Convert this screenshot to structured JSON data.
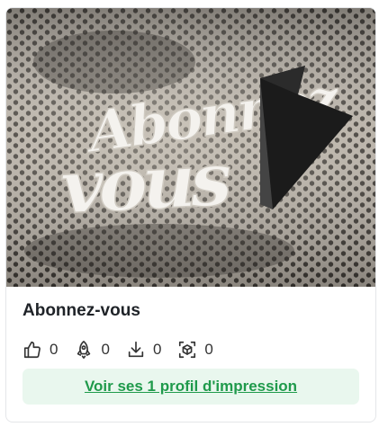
{
  "card": {
    "title": "Abonnez-vous",
    "image_alt": "Abonnez-vous",
    "stats": [
      {
        "icon": "thumbs-up-icon",
        "count": "0"
      },
      {
        "icon": "rocket-icon",
        "count": "0"
      },
      {
        "icon": "download-icon",
        "count": "0"
      },
      {
        "icon": "3d-box-icon",
        "count": "0"
      }
    ],
    "cta_label": "Voir ses 1 profil d'impression",
    "colors": {
      "accent": "#1f9a4b",
      "cta_bg": "#e9f7ee"
    }
  }
}
